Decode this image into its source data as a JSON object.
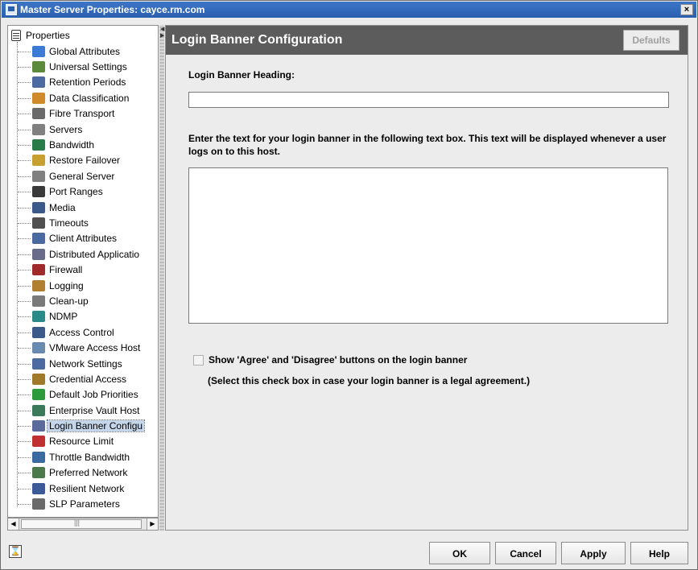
{
  "window": {
    "title": "Master Server Properties: cayce.rm.com",
    "close_label": "×"
  },
  "tree": {
    "root_label": "Properties",
    "items": [
      {
        "label": "Global Attributes",
        "icon": "globe-icon",
        "color": "#3a7bd5"
      },
      {
        "label": "Universal Settings",
        "icon": "network-icon",
        "color": "#5a8a3a"
      },
      {
        "label": "Retention Periods",
        "icon": "clock-icon",
        "color": "#4a6aa0"
      },
      {
        "label": "Data Classification",
        "icon": "classification-icon",
        "color": "#d08a2a"
      },
      {
        "label": "Fibre Transport",
        "icon": "fibre-icon",
        "color": "#6a6a6a"
      },
      {
        "label": "Servers",
        "icon": "server-icon",
        "color": "#808080"
      },
      {
        "label": "Bandwidth",
        "icon": "bandwidth-icon",
        "color": "#2a7a4a"
      },
      {
        "label": "Restore Failover",
        "icon": "restore-icon",
        "color": "#c8a030"
      },
      {
        "label": "General Server",
        "icon": "server-icon",
        "color": "#808080"
      },
      {
        "label": "Port Ranges",
        "icon": "port-icon",
        "color": "#3a3a3a"
      },
      {
        "label": "Media",
        "icon": "media-icon",
        "color": "#3a5a8a"
      },
      {
        "label": "Timeouts",
        "icon": "timeout-icon",
        "color": "#505050"
      },
      {
        "label": "Client Attributes",
        "icon": "client-icon",
        "color": "#4a6aa0"
      },
      {
        "label": "Distributed Applicatio",
        "icon": "distributed-icon",
        "color": "#6a6a8a"
      },
      {
        "label": "Firewall",
        "icon": "firewall-icon",
        "color": "#a02a2a"
      },
      {
        "label": "Logging",
        "icon": "logging-icon",
        "color": "#b08030"
      },
      {
        "label": "Clean-up",
        "icon": "cleanup-icon",
        "color": "#7a7a7a"
      },
      {
        "label": "NDMP",
        "icon": "ndmp-icon",
        "color": "#2a8a8a"
      },
      {
        "label": "Access Control",
        "icon": "access-control-icon",
        "color": "#3a5a8a"
      },
      {
        "label": "VMware Access Host",
        "icon": "vmware-icon",
        "color": "#6a8ab0"
      },
      {
        "label": "Network Settings",
        "icon": "network-icon",
        "color": "#4a6aa0"
      },
      {
        "label": "Credential Access",
        "icon": "credential-icon",
        "color": "#a07a2a"
      },
      {
        "label": "Default Job Priorities",
        "icon": "priority-icon",
        "color": "#2a9a3a"
      },
      {
        "label": "Enterprise Vault Host",
        "icon": "vault-icon",
        "color": "#3a7a5a"
      },
      {
        "label": "Login Banner Configu",
        "icon": "login-banner-icon",
        "color": "#5a6a9a",
        "selected": true
      },
      {
        "label": "Resource Limit",
        "icon": "resource-limit-icon",
        "color": "#c03030"
      },
      {
        "label": "Throttle Bandwidth",
        "icon": "throttle-icon",
        "color": "#3a6aa0"
      },
      {
        "label": "Preferred Network",
        "icon": "preferred-network-icon",
        "color": "#4a7a4a"
      },
      {
        "label": "Resilient Network",
        "icon": "resilient-network-icon",
        "color": "#3a5a9a"
      },
      {
        "label": "SLP Parameters",
        "icon": "slp-icon",
        "color": "#6a6a6a"
      }
    ]
  },
  "panel": {
    "title": "Login Banner Configuration",
    "defaults_label": "Defaults",
    "heading_label": "Login Banner Heading:",
    "heading_value": "",
    "description": "Enter the text for your login banner in the following text box. This text will be displayed whenever a user logs on to this host.",
    "banner_text": "",
    "checkbox_label": "Show 'Agree' and 'Disagree' buttons on the login banner",
    "checkbox_checked": false,
    "checkbox_hint": "(Select this check box in case your login banner is a legal agreement.)"
  },
  "buttons": {
    "ok": "OK",
    "cancel": "Cancel",
    "apply": "Apply",
    "help": "Help"
  },
  "status": {
    "icon": "hourglass-icon",
    "glyph": "⌛"
  }
}
